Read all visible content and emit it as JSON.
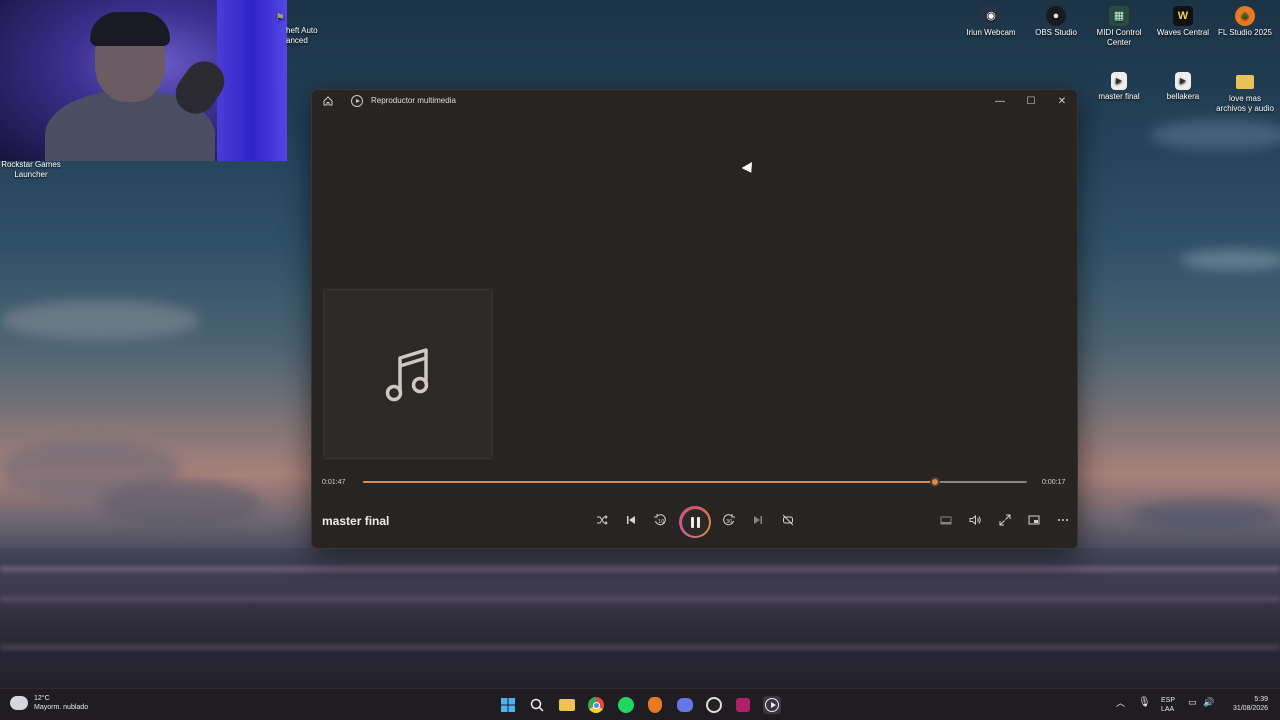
{
  "desktop": {
    "icons": [
      {
        "id": "gta",
        "label": "heft Auto\nanced",
        "color": "#3b4a36",
        "glyph": "⚑"
      },
      {
        "id": "rockstar",
        "label": "Rockstar Games\nLauncher",
        "color": "#e8b23a",
        "glyph": "R"
      },
      {
        "id": "iriun",
        "label": "Iriun Webcam",
        "color": "#2f3b4a",
        "glyph": "◉"
      },
      {
        "id": "obs",
        "label": "OBS Studio",
        "color": "#2a2a2a",
        "glyph": "●"
      },
      {
        "id": "midi",
        "label": "MIDI Control\nCenter",
        "color": "#3a5a4a",
        "glyph": "▦"
      },
      {
        "id": "waves",
        "label": "Waves Central",
        "color": "#222",
        "glyph": "W"
      },
      {
        "id": "fl",
        "label": "FL Studio 2025",
        "color": "#e07a2a",
        "glyph": "♣"
      },
      {
        "id": "master",
        "label": "master final",
        "color": "#e8e8e8",
        "glyph": "▶"
      },
      {
        "id": "bellakera",
        "label": "bellakera",
        "color": "#e8e8e8",
        "glyph": "▶"
      },
      {
        "id": "folder",
        "label": "love mas\narchivos y audio",
        "color": "#e8c15a",
        "glyph": ""
      }
    ]
  },
  "window": {
    "title": "Reproductor multimedia",
    "minimize_glyph": "—",
    "maximize_glyph": "☐",
    "close_glyph": "✕"
  },
  "player": {
    "track_title": "master final",
    "elapsed": "0:01:47",
    "remaining": "0:00:17",
    "progress_fraction": 0.862,
    "accent": "#d98a4e",
    "controls": {
      "shuffle": "shuffle-icon",
      "previous": "previous-icon",
      "skip_back": "skip-back-10-icon",
      "pause": "pause-icon",
      "skip_forward": "skip-forward-30-icon",
      "next": "next-icon",
      "repeat": "repeat-off-icon",
      "miniplayer": "miniplayer-icon",
      "volume": "volume-icon",
      "fullscreen": "fullscreen-icon",
      "cast": "cast-icon",
      "more": "more-icon"
    }
  },
  "taskbar": {
    "weather_temp": "12°C",
    "weather_desc": "Mayorm. nublado",
    "lang_top": "ESP",
    "lang_bottom": "LAA",
    "time": "5:39",
    "date": "31/08/2026"
  }
}
